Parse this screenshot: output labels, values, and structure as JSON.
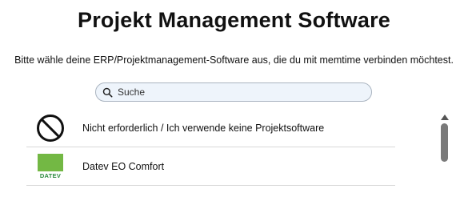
{
  "page": {
    "title": "Projekt Management Software",
    "subtitle": "Bitte wähle deine ERP/Projektmanagement-Software aus, die du mit memtime verbinden möchtest."
  },
  "search": {
    "placeholder": "Suche",
    "icon": "search-icon"
  },
  "list": {
    "items": [
      {
        "label": "Nicht erforderlich / Ich verwende keine Projektsoftware",
        "icon": "prohibited-icon"
      },
      {
        "label": "Datev EO Comfort",
        "icon": "datev-logo",
        "logo_text": "DATEV"
      }
    ]
  },
  "colors": {
    "search_bg": "#eef4fb",
    "datev_green": "#73b844",
    "divider": "#d9d9d9"
  }
}
